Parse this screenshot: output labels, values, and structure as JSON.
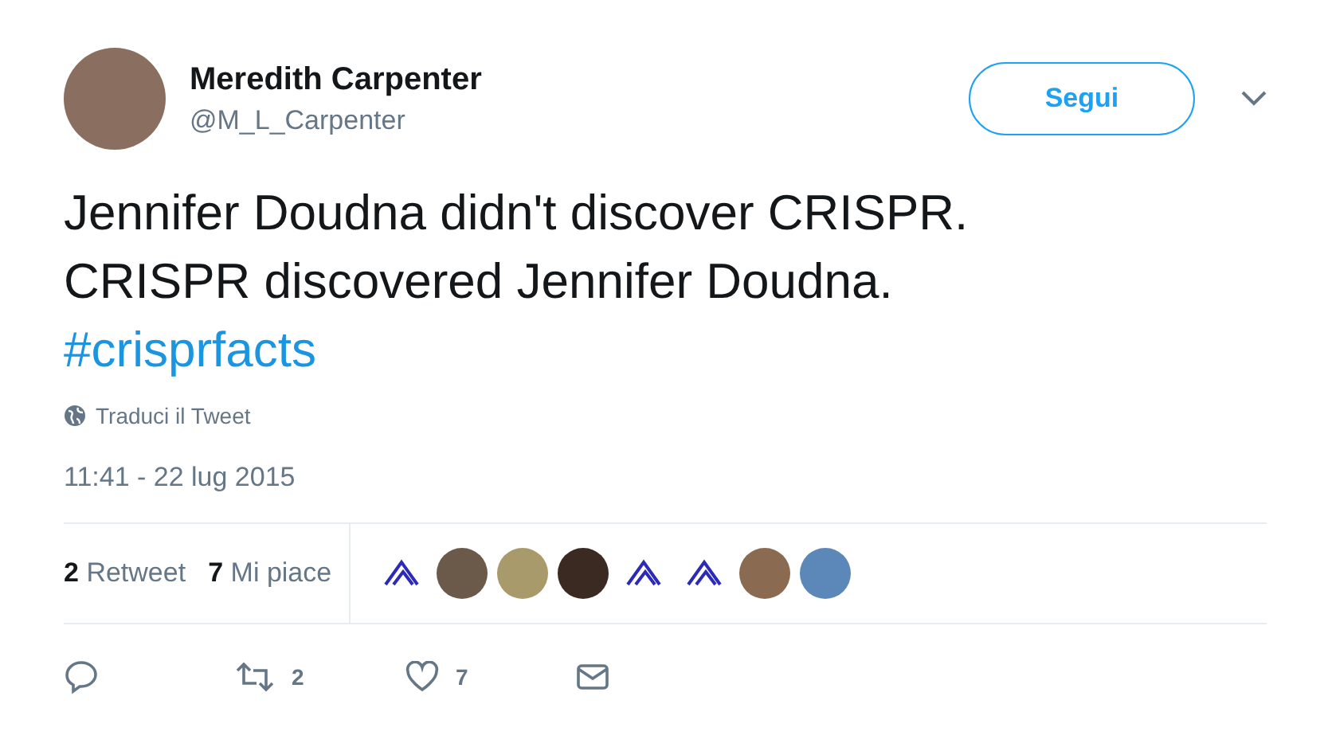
{
  "author": {
    "name": "Meredith Carpenter",
    "handle": "@M_L_Carpenter"
  },
  "follow_button": "Segui",
  "tweet": {
    "lines": [
      "Jennifer Doudna didn't discover CRISPR.",
      "CRISPR discovered Jennifer Doudna."
    ],
    "hashtag": "#crisprfacts"
  },
  "translate": "Traduci il Tweet",
  "timestamp": "11:41 - 22 lug 2015",
  "stats": [
    {
      "count": "2",
      "label": "Retweet"
    },
    {
      "count": "7",
      "label": "Mi piace"
    }
  ],
  "likers": [
    {
      "kind": "logo"
    },
    {
      "kind": "photo"
    },
    {
      "kind": "photo"
    },
    {
      "kind": "photo"
    },
    {
      "kind": "logo"
    },
    {
      "kind": "logo"
    },
    {
      "kind": "photo"
    },
    {
      "kind": "photo"
    }
  ],
  "actions": [
    {
      "kind": "reply"
    },
    {
      "kind": "retweet",
      "count": "2"
    },
    {
      "kind": "like",
      "count": "7"
    },
    {
      "kind": "message"
    }
  ]
}
